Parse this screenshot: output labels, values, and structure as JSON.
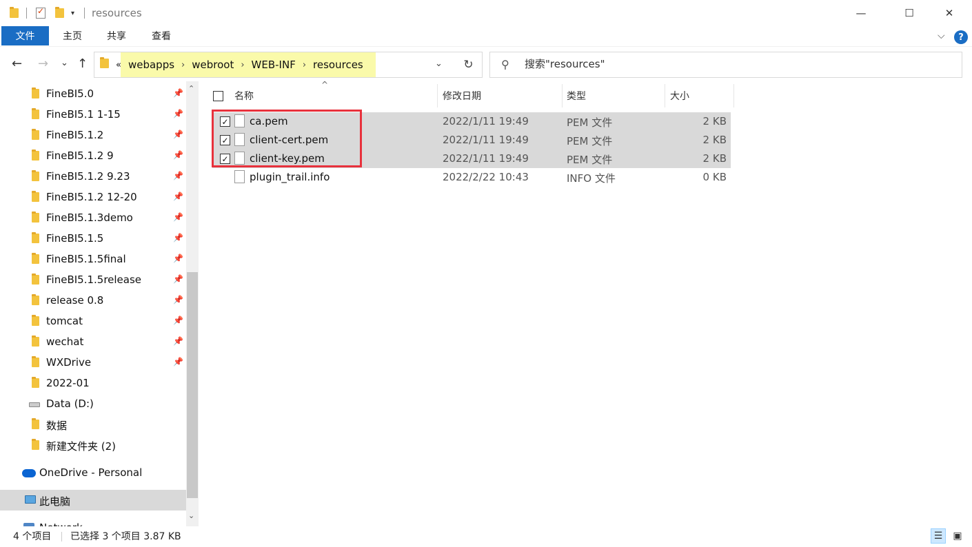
{
  "window": {
    "title": "resources",
    "minimize_glyph": "—",
    "maximize_glyph": "☐",
    "close_glyph": "✕"
  },
  "ribbon": {
    "tabs": [
      "文件",
      "主页",
      "共享",
      "查看"
    ],
    "expand_glyph": "⌵",
    "help_glyph": "?"
  },
  "nav": {
    "back_glyph": "←",
    "forward_glyph": "→",
    "recent_glyph": "⌄",
    "up_glyph": "↑",
    "overflow": "«",
    "breadcrumbs": [
      "webapps",
      "webroot",
      "WEB-INF",
      "resources"
    ],
    "crumb_sep": "›",
    "address_dropdown": "⌄",
    "refresh_glyph": "↻",
    "search_placeholder": "搜索\"resources\"",
    "search_glyph": "⚲"
  },
  "sidebar": {
    "items": [
      {
        "label": "FineBI5.0",
        "icon": "folder-icon",
        "pinned": true
      },
      {
        "label": "FineBI5.1 1-15",
        "icon": "folder-icon",
        "pinned": true
      },
      {
        "label": "FineBI5.1.2",
        "icon": "folder-icon",
        "pinned": true
      },
      {
        "label": "FineBI5.1.2 9",
        "icon": "folder-icon",
        "pinned": true
      },
      {
        "label": "FineBI5.1.2 9.23",
        "icon": "folder-icon",
        "pinned": true
      },
      {
        "label": "FineBI5.1.2 12-20",
        "icon": "folder-icon",
        "pinned": true
      },
      {
        "label": "FineBI5.1.3demo",
        "icon": "folder-icon",
        "pinned": true
      },
      {
        "label": "FineBI5.1.5",
        "icon": "folder-icon",
        "pinned": true
      },
      {
        "label": "FineBI5.1.5final",
        "icon": "folder-icon",
        "pinned": true
      },
      {
        "label": "FineBI5.1.5release",
        "icon": "folder-icon",
        "pinned": true
      },
      {
        "label": "release 0.8",
        "icon": "folder-icon",
        "pinned": true
      },
      {
        "label": "tomcat",
        "icon": "folder-icon",
        "pinned": true
      },
      {
        "label": "wechat",
        "icon": "folder-icon",
        "pinned": true
      },
      {
        "label": "WXDrive",
        "icon": "folder-icon",
        "pinned": true
      },
      {
        "label": "2022-01",
        "icon": "folder-icon",
        "pinned": false
      },
      {
        "label": "Data (D:)",
        "icon": "drive-icon",
        "pinned": false
      },
      {
        "label": "数据",
        "icon": "folder-icon",
        "pinned": false
      },
      {
        "label": "新建文件夹 (2)",
        "icon": "folder-icon",
        "pinned": false
      },
      {
        "label": "OneDrive - Personal",
        "icon": "onedrive-icon",
        "pinned": false
      },
      {
        "label": "此电脑",
        "icon": "this-pc-icon",
        "pinned": false,
        "selected": true
      },
      {
        "label": "Network",
        "icon": "network-icon",
        "pinned": false
      }
    ],
    "pin_glyph": "📌",
    "scroll_up": "⌃",
    "scroll_down": "⌄"
  },
  "filelist": {
    "columns": {
      "name": "名称",
      "date": "修改日期",
      "type": "类型",
      "size": "大小"
    },
    "sort_caret": "^",
    "check_glyph": "✓",
    "rows": [
      {
        "name": "ca.pem",
        "date": "2022/1/11 19:49",
        "type": "PEM 文件",
        "size": "2 KB",
        "selected": true
      },
      {
        "name": "client-cert.pem",
        "date": "2022/1/11 19:49",
        "type": "PEM 文件",
        "size": "2 KB",
        "selected": true
      },
      {
        "name": "client-key.pem",
        "date": "2022/1/11 19:49",
        "type": "PEM 文件",
        "size": "2 KB",
        "selected": true
      },
      {
        "name": "plugin_trail.info",
        "date": "2022/2/22 10:43",
        "type": "INFO 文件",
        "size": "0 KB",
        "selected": false
      }
    ]
  },
  "status": {
    "item_count": "4 个项目",
    "selection": "已选择 3 个项目  3.87 KB",
    "details_view_glyph": "☰",
    "large_icons_glyph": "▣"
  },
  "colors": {
    "accent": "#1a6dc4",
    "highlight": "#fafaaa",
    "annotation": "#e8313c",
    "selection": "#d9d9d9"
  }
}
